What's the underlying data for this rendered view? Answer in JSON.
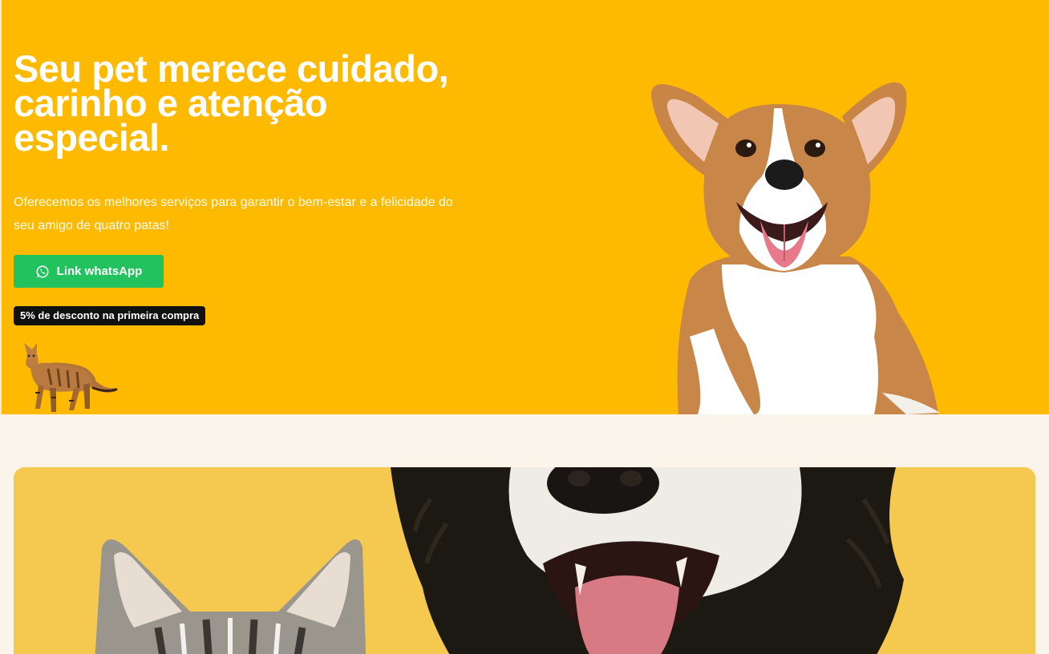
{
  "hero": {
    "title_lines": [
      "Seu pet merece cuidado,",
      "carinho e atenção",
      "especial."
    ],
    "subtitle_line1": "Oferecemos os melhores serviços para garantir o bem-estar e a felicidade do",
    "subtitle_line2": "seu amigo de quatro patas!",
    "cta_label": "Link whatsApp",
    "cta_icon": "whatsapp-icon",
    "discount_badge": "5% de desconto na primeira compra"
  },
  "colors": {
    "hero_background": "#feb901",
    "page_background": "#fbf4ea",
    "cta_green": "#22c35e",
    "badge_black": "#111111",
    "showcase_yellow": "#f4c443"
  },
  "images": {
    "hero_dog": "corgi-dog-image",
    "hero_cat": "walking-cat-image",
    "showcase": "cat-and-dog-image"
  }
}
